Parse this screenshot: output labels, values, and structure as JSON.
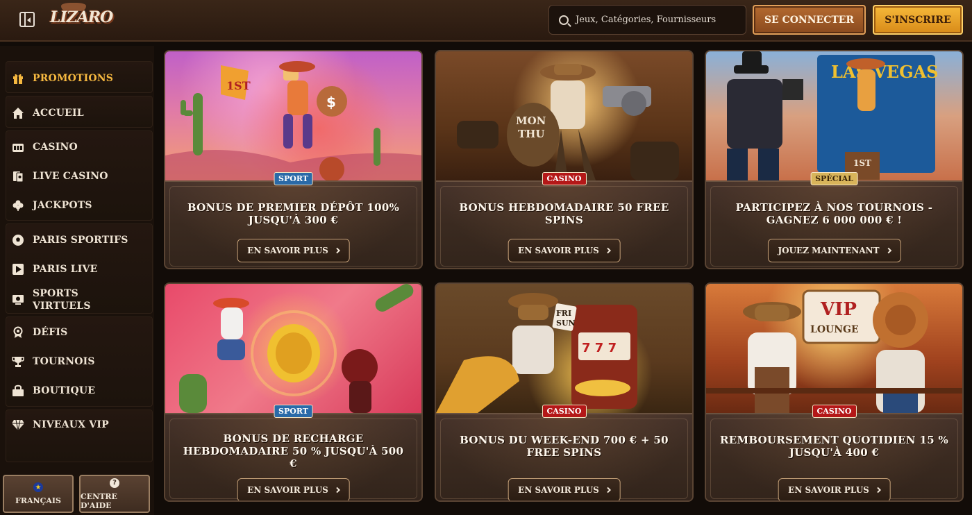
{
  "header": {
    "logo": "LIZARO",
    "search_placeholder": "Jeux, Catégories, Fournisseurs",
    "login_label": "SE CONNECTER",
    "signup_label": "S'INSCRIRE"
  },
  "sidebar": {
    "items": [
      {
        "label": "PROMOTIONS",
        "icon": "gift-icon",
        "active": true
      },
      {
        "label": "ACCUEIL",
        "icon": "home-icon"
      },
      {
        "label": "CASINO",
        "icon": "casino-icon"
      },
      {
        "label": "LIVE CASINO",
        "icon": "live-cards-icon"
      },
      {
        "label": "JACKPOTS",
        "icon": "clover-icon"
      },
      {
        "label": "PARIS SPORTIFS",
        "icon": "soccer-ball-icon"
      },
      {
        "label": "PARIS LIVE",
        "icon": "play-icon"
      },
      {
        "label": "SPORTS VIRTUELS",
        "icon": "virtual-sports-icon"
      },
      {
        "label": "DÉFIS",
        "icon": "badge-icon"
      },
      {
        "label": "TOURNOIS",
        "icon": "trophy-icon"
      },
      {
        "label": "BOUTIQUE",
        "icon": "shop-bag-icon"
      },
      {
        "label": "NIVEAUX VIP",
        "icon": "diamond-icon"
      }
    ],
    "footer": {
      "language_label": "FRANÇAIS",
      "help_label": "CENTRE D'AIDE"
    }
  },
  "promotions": [
    {
      "badge": "SPORT",
      "title": "BONUS DE PREMIER DÉPÔT 100% JUSQU'À 300 €",
      "button": "EN SAVOIR PLUS"
    },
    {
      "badge": "CASINO",
      "title": "BONUS HEBDOMADAIRE 50 FREE SPINS",
      "button": "EN SAVOIR PLUS"
    },
    {
      "badge": "SPÉCIAL",
      "title": "PARTICIPEZ À NOS TOURNOIS - GAGNEZ 6 000 000 € !",
      "button": "JOUEZ MAINTENANT"
    },
    {
      "badge": "SPORT",
      "title": "BONUS DE RECHARGE HEBDOMADAIRE 50 % JUSQU'À 500 €",
      "button": "EN SAVOIR PLUS"
    },
    {
      "badge": "CASINO",
      "title": "BONUS DU WEEK-END 700 € + 50 FREE SPINS",
      "button": "EN SAVOIR PLUS"
    },
    {
      "badge": "CASINO",
      "title": "REMBOURSEMENT QUOTIDIEN 15 % JUSQU'À 400 €",
      "button": "EN SAVOIR PLUS"
    }
  ],
  "colors": {
    "accent": "#f5b840",
    "sport_badge": "#2a6aa8",
    "casino_badge": "#b41818",
    "special_badge": "#d8b45a"
  }
}
